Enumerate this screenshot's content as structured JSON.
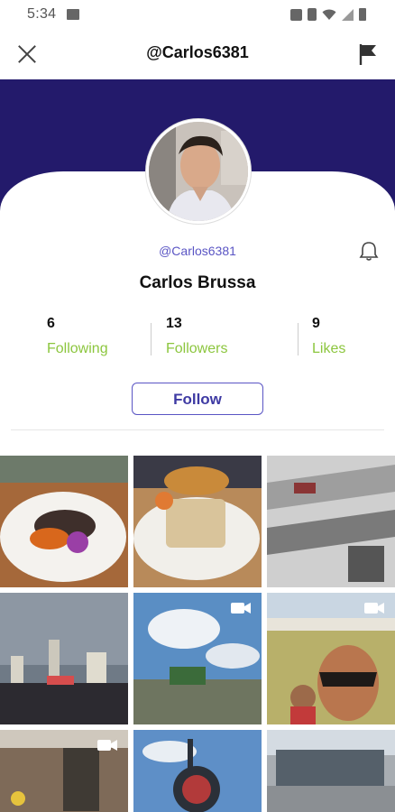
{
  "status_bar": {
    "time": "5:34"
  },
  "header": {
    "title": "@Carlos6381",
    "close_icon": "close-icon",
    "flag_icon": "flag-icon"
  },
  "profile": {
    "handle": "@Carlos6381",
    "name": "Carlos Brussa",
    "follow_label": "Follow"
  },
  "stats": [
    {
      "value": "6",
      "label": "Following"
    },
    {
      "value": "13",
      "label": "Followers"
    },
    {
      "value": "9",
      "label": "Likes"
    }
  ],
  "colors": {
    "banner": "#231a6b",
    "accent": "#5a55c4",
    "stat_label": "#8cc63e"
  },
  "posts": [
    {
      "kind": "photo",
      "subject": "plated food dish"
    },
    {
      "kind": "photo",
      "subject": "wrap sandwich on plate"
    },
    {
      "kind": "photo",
      "subject": "building interior"
    },
    {
      "kind": "photo",
      "subject": "city skyline concert"
    },
    {
      "kind": "video",
      "subject": "festival crowd"
    },
    {
      "kind": "video",
      "subject": "selfie at festival"
    },
    {
      "kind": "video",
      "subject": "restaurant interior"
    },
    {
      "kind": "photo",
      "subject": "wharf sign"
    },
    {
      "kind": "photo",
      "subject": "street plaza"
    }
  ]
}
